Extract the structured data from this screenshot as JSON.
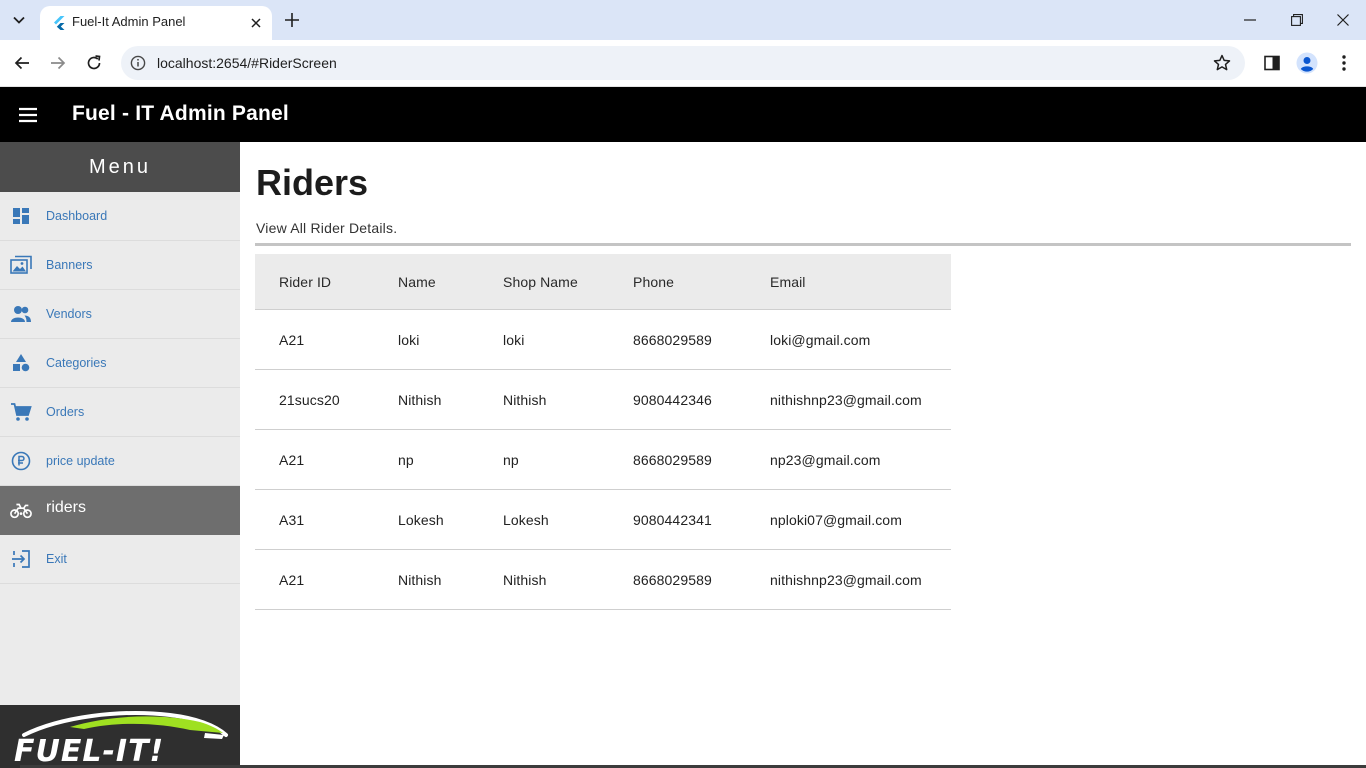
{
  "browser": {
    "tab_title": "Fuel-It Admin Panel",
    "url": "localhost:2654/#RiderScreen"
  },
  "appbar": {
    "title": "Fuel - IT Admin Panel"
  },
  "sidebar": {
    "header": "Menu",
    "items": [
      {
        "label": "Dashboard",
        "icon": "dashboard-icon"
      },
      {
        "label": "Banners",
        "icon": "image-icon"
      },
      {
        "label": "Vendors",
        "icon": "people-icon"
      },
      {
        "label": "Categories",
        "icon": "category-icon"
      },
      {
        "label": "Orders",
        "icon": "cart-icon"
      },
      {
        "label": "price update",
        "icon": "rupee-icon"
      },
      {
        "label": "riders",
        "icon": "bike-icon",
        "active": true
      },
      {
        "label": "Exit",
        "icon": "exit-icon"
      }
    ],
    "logo_text": "FUEL-IT!"
  },
  "main": {
    "title": "Riders",
    "subtitle": "View All Rider Details.",
    "table": {
      "columns": [
        "Rider ID",
        "Name",
        "Shop Name",
        "Phone",
        "Email"
      ],
      "rows": [
        [
          "A21",
          "loki",
          "loki",
          "8668029589",
          "loki@gmail.com"
        ],
        [
          "21sucs20",
          "Nithish",
          "Nithish",
          "9080442346",
          "nithishnp23@gmail.com"
        ],
        [
          "A21",
          "np",
          "np",
          "8668029589",
          "np23@gmail.com"
        ],
        [
          "A31",
          "Lokesh",
          "Lokesh",
          "9080442341",
          "nploki07@gmail.com"
        ],
        [
          "A21",
          "Nithish",
          "Nithish",
          "8668029589",
          "nithishnp23@gmail.com"
        ]
      ]
    }
  },
  "colors": {
    "appbar_bg": "#000000",
    "sidebar_bg": "#ebebeb",
    "menu_header_bg": "#4c4c4c",
    "active_item_bg": "#6e6e6e",
    "link_blue": "#3a78b8",
    "logo_green": "#9fe021"
  }
}
